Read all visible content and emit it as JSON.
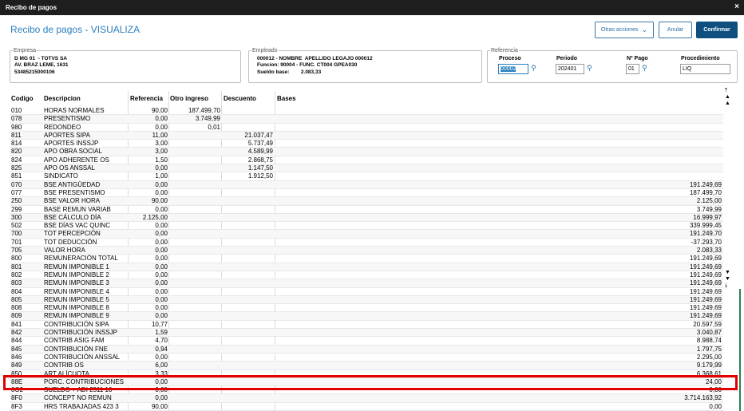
{
  "window": {
    "title": "Recibo de pagos",
    "close": "×"
  },
  "page": {
    "title": "Recibo de pagos - VISUALIZA"
  },
  "toolbar": {
    "otras_acciones": "Otras acciones",
    "anular": "Anular",
    "confirmar": "Confirmar"
  },
  "empresa": {
    "legend": "Empresa",
    "line1": "D MG 01  - TOTVS SA",
    "line2": "AV. BRAZ LEME, 1631",
    "line3": "53485215000106"
  },
  "empleado": {
    "legend": "Empleado",
    "line1": "000012 - NOMBRE  APELLIDO LEGAJO 000012",
    "line2": "Funcion: 90004 - FUNC. CT004 GPEA030",
    "line3": "Sueldo base:        2.083,33"
  },
  "referencia": {
    "legend": "Referencia",
    "proceso_label": "Proceso",
    "proceso_value": "00002",
    "periodo_label": "Periodo",
    "periodo_value": "202401",
    "npago_label": "Nº Pago",
    "npago_value": "01",
    "procedimiento_label": "Procedimiento",
    "procedimiento_value": "LIQ"
  },
  "table": {
    "headers": [
      "Codigo",
      "Descripcion",
      "Referencia",
      "Otro ingreso",
      "Descuento",
      "Bases"
    ],
    "rows": [
      [
        "010",
        "HORAS NORMALES",
        "90,00",
        "187.499,70",
        "",
        ""
      ],
      [
        "078",
        "PRESENTISMO",
        "0,00",
        "3.749,99",
        "",
        ""
      ],
      [
        "980",
        "REDONDEO",
        "0,00",
        "0,01",
        "",
        ""
      ],
      [
        "811",
        "APORTES SIPA",
        "11,00",
        "",
        "21.037,47",
        ""
      ],
      [
        "814",
        "APORTES INSSJP",
        "3,00",
        "",
        "5.737,49",
        ""
      ],
      [
        "820",
        "APO OBRA SOCIAL",
        "3,00",
        "",
        "4.589,99",
        ""
      ],
      [
        "824",
        "APO ADHERENTE OS",
        "1,50",
        "",
        "2.868,75",
        ""
      ],
      [
        "825",
        "APO OS ANSSAL",
        "0,00",
        "",
        "1.147,50",
        ""
      ],
      [
        "851",
        "SINDICATO",
        "1,00",
        "",
        "1.912,50",
        ""
      ],
      [
        "070",
        "BSE ANTIGÜEDAD",
        "0,00",
        "",
        "",
        "191.249,69"
      ],
      [
        "077",
        "BSE PRESENTISMO",
        "0,00",
        "",
        "",
        "187.499,70"
      ],
      [
        "250",
        "BSE VALOR HORA",
        "90,00",
        "",
        "",
        "2.125,00"
      ],
      [
        "299",
        "BASE REMUN VARIAB",
        "0,00",
        "",
        "",
        "3.749,99"
      ],
      [
        "300",
        "BSE CÁLCULO DÍA",
        "2.125,00",
        "",
        "",
        "16.999,97"
      ],
      [
        "502",
        "BSE DÍAS VAC QUINC",
        "0,00",
        "",
        "",
        "339.999,45"
      ],
      [
        "700",
        "TOT PERCEPCIÓN",
        "0,00",
        "",
        "",
        "191.249,70"
      ],
      [
        "701",
        "TOT DEDUCCIÓN",
        "0,00",
        "",
        "",
        "-37.293,70"
      ],
      [
        "705",
        "VALOR HORA",
        "0,00",
        "",
        "",
        "2.083,33"
      ],
      [
        "800",
        "REMUNERACIÓN TOTAL",
        "0,00",
        "",
        "",
        "191.249,69"
      ],
      [
        "801",
        "REMUN IMPONIBLE 1",
        "0,00",
        "",
        "",
        "191.249,69"
      ],
      [
        "802",
        "REMUN IMPONIBLE 2",
        "0,00",
        "",
        "",
        "191.249,69"
      ],
      [
        "803",
        "REMUN IMPONIBLE 3",
        "0,00",
        "",
        "",
        "191.249,69"
      ],
      [
        "804",
        "REMUN IMPONIBLE 4",
        "0,00",
        "",
        "",
        "191.249,69"
      ],
      [
        "805",
        "REMUN IMPONIBLE 5",
        "0,00",
        "",
        "",
        "191.249,69"
      ],
      [
        "808",
        "REMUN IMPONIBLE 8",
        "0,00",
        "",
        "",
        "191.249,69"
      ],
      [
        "809",
        "REMUN IMPONIBLE 9",
        "0,00",
        "",
        "",
        "191.249,69"
      ],
      [
        "841",
        "CONTRIBUCIÓN SIPA",
        "10,77",
        "",
        "",
        "20.597,59"
      ],
      [
        "842",
        "CONTRIBUCIÓN INSSJP",
        "1,59",
        "",
        "",
        "3.040,87"
      ],
      [
        "844",
        "CONTRIB ASIG FAM",
        "4,70",
        "",
        "",
        "8.988,74"
      ],
      [
        "845",
        "CONTRIBUCIÓN FNE",
        "0,94",
        "",
        "",
        "1.797,75"
      ],
      [
        "846",
        "CONTRIBUCIÓN ANSSAL",
        "0,00",
        "",
        "",
        "2.295,00"
      ],
      [
        "849",
        "CONTRIB OS",
        "6,00",
        "",
        "",
        "9.179,99"
      ],
      [
        "850",
        "ART ALÍCUOTA",
        "3,33",
        "",
        "",
        "6.368,61"
      ],
      [
        "88E",
        "PORC. CONTRIBUCIONES",
        "0,00",
        "",
        "",
        "24,00"
      ],
      [
        "8O2",
        "SUELDO + ADI 2511 10",
        "0,00",
        "",
        "",
        "0,00"
      ],
      [
        "8F0",
        "CONCEPT NO REMUN",
        "0,00",
        "",
        "",
        "3.714.163,92"
      ],
      [
        "8F3",
        "HRS TRABAJADAS 423 3",
        "90,00",
        "",
        "",
        "0,00"
      ]
    ]
  }
}
